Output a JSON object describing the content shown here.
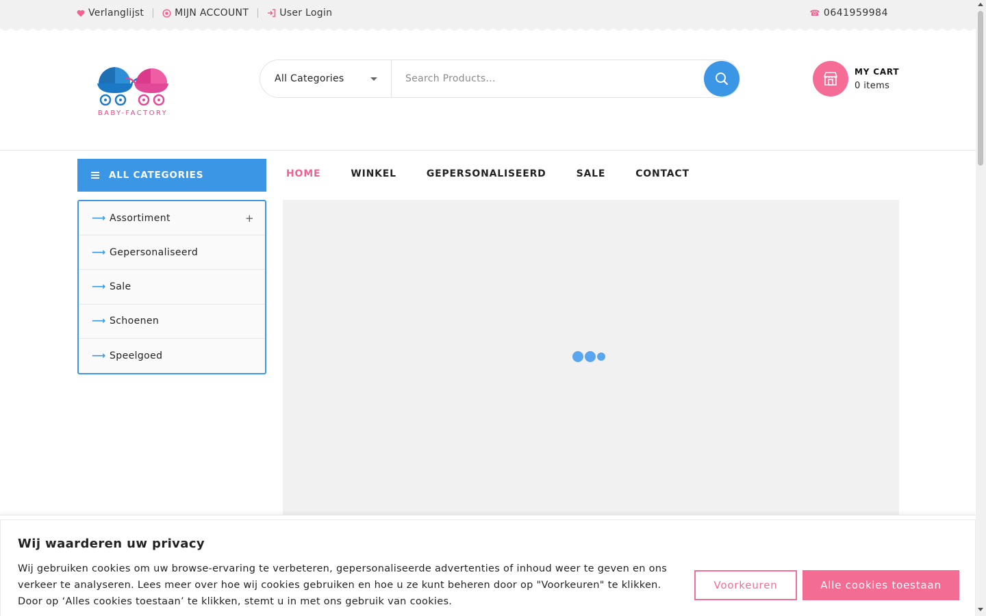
{
  "topbar": {
    "wishlist": "Verlanglijst",
    "account": "MIJN ACCOUNT",
    "login": "User Login",
    "phone": "0641959984"
  },
  "logo": {
    "text": "BABY-FACTORY"
  },
  "search": {
    "category": "All Categories",
    "placeholder": "Search Products..."
  },
  "cart": {
    "title": "MY CART",
    "count": "0 items"
  },
  "sidebar": {
    "header": "ALL CATEGORIES",
    "items": [
      {
        "label": "Assortiment",
        "expandable": true
      },
      {
        "label": "Gepersonaliseerd"
      },
      {
        "label": "Sale"
      },
      {
        "label": "Schoenen"
      },
      {
        "label": "Speelgoed"
      }
    ]
  },
  "nav": {
    "items": [
      {
        "label": "HOME",
        "active": true
      },
      {
        "label": "WINKEL"
      },
      {
        "label": "GEPERSONALISEERD"
      },
      {
        "label": "SALE"
      },
      {
        "label": "CONTACT"
      }
    ]
  },
  "cookie": {
    "title": "Wij waarderen uw privacy",
    "text": "Wij gebruiken cookies om uw browse-ervaring te verbeteren, gepersonaliseerde advertenties of inhoud weer te geven en ons verkeer te analyseren. Lees meer over hoe wij cookies gebruiken en hoe u ze kunt beheren door op \"Voorkeuren\" te klikken. Door op ‘Alles cookies toestaan’ te klikken, stemt u in met ons gebruik van cookies.",
    "preferences_label": "Voorkeuren",
    "accept_all_label": "Alle cookies toestaan"
  },
  "colors": {
    "accent_blue": "#3b97e6",
    "accent_pink": "#f26c93"
  }
}
